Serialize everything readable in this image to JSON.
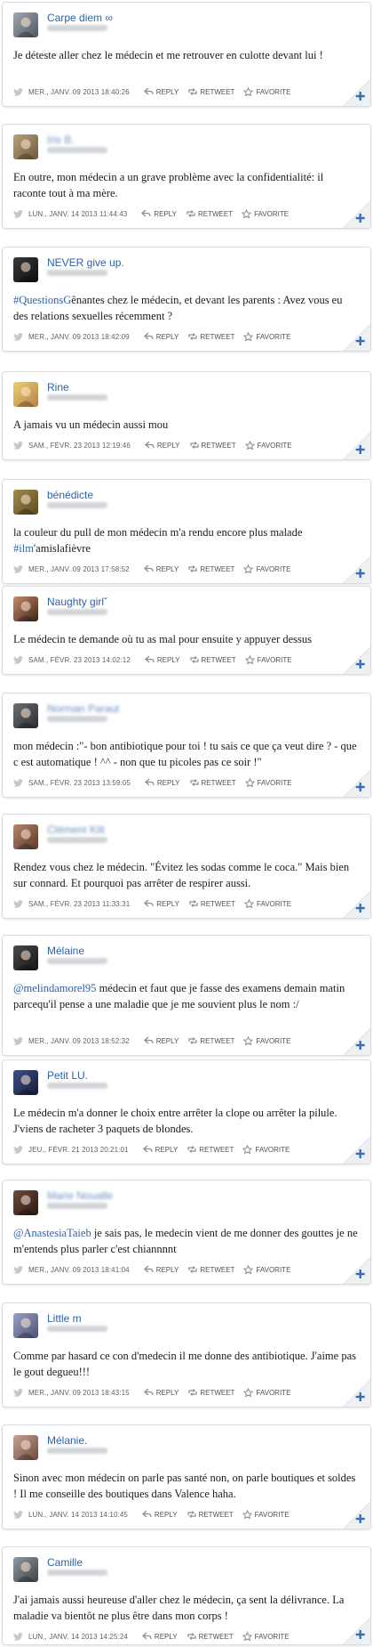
{
  "actions": {
    "reply": "REPLY",
    "retweet": "RETWEET",
    "favorite": "FAVORITE"
  },
  "colors": {
    "link": "#2d62a8",
    "card_border": "#d9dde1",
    "corner_plus": "#3b6eb0"
  },
  "tweets": [
    {
      "name": "Carpe diem ∞",
      "name_blurred": false,
      "avatar": [
        "#9fa8b3",
        "#50575f"
      ],
      "text": [
        "Je déteste aller chez le médecin et me retrouver en culotte devant lui !"
      ],
      "timestamp": "MER., JANV. 09 2013 18:40:26"
    },
    {
      "name": "Iris B.",
      "name_blurred": true,
      "avatar": [
        "#b8a27a",
        "#6e5a3d"
      ],
      "text": [
        "En outre, mon médecin a un grave problème avec la confidentialité: il raconte tout à ma mère."
      ],
      "timestamp": "LUN., JANV. 14 2013 11:44:43"
    },
    {
      "name": "NEVER give up.",
      "name_blurred": false,
      "avatar": [
        "#3a3a3a",
        "#0e0e0e"
      ],
      "tag": "#QuestionsG",
      "text": [
        "ênantes chez le médecin, et devant les parents : Avez vous eu des relations sexuelles récemment ?"
      ],
      "timestamp": "MER., JANV. 09 2013 18:42:09"
    },
    {
      "name": "Rine",
      "name_blurred": false,
      "avatar": [
        "#e9d26a",
        "#b77f4c"
      ],
      "text": [
        "A jamais vu un médecin aussi mou"
      ],
      "timestamp": "SAM., FÉVR. 23 2013 12:19:46"
    },
    {
      "name": "bénédicte",
      "name_blurred": false,
      "avatar": [
        "#a48b4c",
        "#5b4a22"
      ],
      "text": [
        "la couleur du pull de mon médecin m'a rendu encore plus malade ",
        "#ilm",
        "'amislafièvre"
      ],
      "timestamp": "MER., JANV. 09 2013 17:58:52"
    },
    {
      "name": "Naughty girlˇ",
      "name_blurred": false,
      "avatar": [
        "#c98b6b",
        "#3e2418"
      ],
      "text": [
        "Le médecin te demande où tu as mal pour ensuite y appuyer dessus"
      ],
      "timestamp": "SAM., FÉVR. 23 2013 14:02:12"
    },
    {
      "name": "Norman Paraut",
      "name_blurred": true,
      "avatar": [
        "#6a6f75",
        "#2b2e31"
      ],
      "text": [
        "mon médecin :\"- bon antibiotique pour toi ! tu sais ce que ça veut dire ? - que c est automatique ! ^^ - non que tu picoles pas ce soir !\""
      ],
      "timestamp": "SAM., FÉVR. 23 2013 13:59:05"
    },
    {
      "name": "Clément Kilt",
      "name_blurred": true,
      "avatar": [
        "#b5866a",
        "#5a3b2a"
      ],
      "text": [
        "Rendez vous chez le médecin. \"Évitez les sodas comme le coca.\" Mais bien sur connard. Et pourquoi pas arrêter de respirer aussi."
      ],
      "timestamp": "SAM., FÉVR. 23 2013 11:33:31"
    },
    {
      "name": "Mélaine",
      "name_blurred": false,
      "avatar": [
        "#4a4a4a",
        "#151515"
      ],
      "tag": "@melindamorel95",
      "text": [
        " médecin et faut que je fasse des examens demain matin parcequ'il pense a une maladie que je me souvient plus le nom :/"
      ],
      "timestamp": "MER., JANV. 09 2013 18:52:32"
    },
    {
      "name": "Petit LU.",
      "name_blurred": false,
      "avatar": [
        "#3e4f8a",
        "#161c33"
      ],
      "text": [
        "Le médecin m'a donner le choix entre arrêter la clope ou arrêter la pilule. J'viens de racheter 3 paquets de blondes."
      ],
      "timestamp": "JEU., FÉVR. 21 2013 20:21:01"
    },
    {
      "name": "Marie Noualle",
      "name_blurred": true,
      "avatar": [
        "#6d4b3d",
        "#2a1a12"
      ],
      "tag": "@AnastesiaTaieb",
      "text": [
        " je sais pas, le medecin vient de me donner des gouttes je ne m'entends plus parler c'est chiannnnt"
      ],
      "timestamp": "MER., JANV. 09 2013 18:41:04"
    },
    {
      "name": "Little m",
      "name_blurred": false,
      "avatar": [
        "#9aa0c8",
        "#4e5374"
      ],
      "text": [
        "Comme par hasard ce con d'medecin il me donne des antibiotique. J'aime pas le gout degueu!!!"
      ],
      "timestamp": "MER., JANV. 09 2013 18:43:15"
    },
    {
      "name": "Mélanie.",
      "name_blurred": false,
      "avatar": [
        "#c9a394",
        "#6b4a40"
      ],
      "text": [
        "Sinon avec mon médecin on parle pas santé non, on parle boutiques et soldes ! Il me conseille des boutiques dans Valence haha."
      ],
      "timestamp": "LUN., JANV. 14 2013 14:10:45"
    },
    {
      "name": "Camille",
      "name_blurred": false,
      "avatar": [
        "#8f9aa0",
        "#3c4448"
      ],
      "text": [
        "J'ai jamais aussi heureuse d'aller chez le médecin, ça sent la délivrance. La maladie va bientôt ne plus être dans mon corps !"
      ],
      "timestamp": "LUN., JANV. 14 2013 14:25:24"
    }
  ]
}
